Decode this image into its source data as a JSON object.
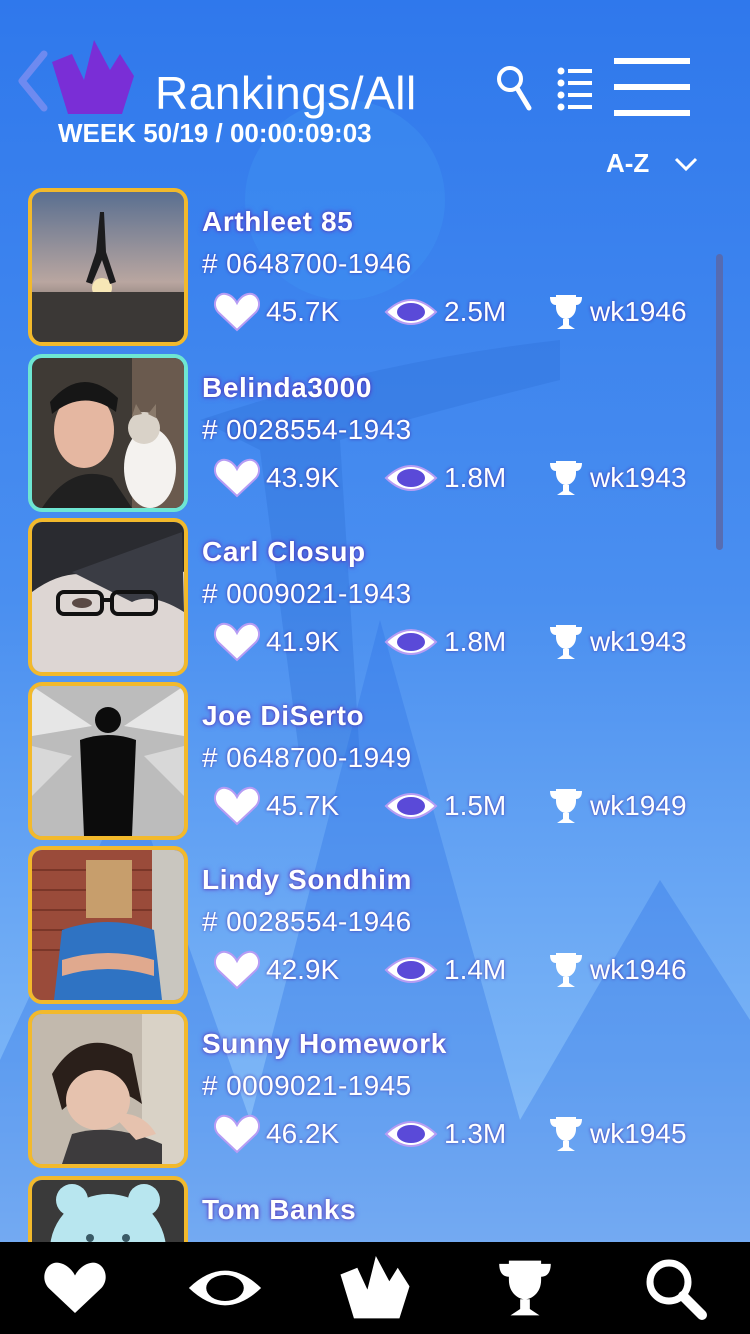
{
  "header": {
    "title": "Rankings/All",
    "subtitle": "WEEK 50/19 / 00:00:09:03",
    "sort_label": "A-Z"
  },
  "colors": {
    "accent_purple": "#7a2ed6",
    "avatar_border_gold": "#f2b92c",
    "avatar_border_teal": "#6ee6d2",
    "nav_bg": "#000000"
  },
  "icons": {
    "back": "chevron-left-icon",
    "logo": "crown-logo",
    "search": "search-icon",
    "list": "list-icon",
    "menu": "hamburger-menu-icon",
    "sort": "chevron-down-icon",
    "likes": "heart-icon",
    "views": "eye-icon",
    "rank": "trophy-icon"
  },
  "rankings": [
    {
      "name": "Arthleet 85",
      "code": "# 0648700-1946",
      "likes": "45.7K",
      "views": "2.5M",
      "week": "wk1946"
    },
    {
      "name": "Belinda3000",
      "code": "# 0028554-1943",
      "likes": "43.9K",
      "views": "1.8M",
      "week": "wk1943"
    },
    {
      "name": "Carl Closup",
      "code": "# 0009021-1943",
      "likes": "41.9K",
      "views": "1.8M",
      "week": "wk1943"
    },
    {
      "name": "Joe DiSerto",
      "code": "# 0648700-1949",
      "likes": "45.7K",
      "views": "1.5M",
      "week": "wk1949"
    },
    {
      "name": "Lindy Sondhim",
      "code": "# 0028554-1946",
      "likes": "42.9K",
      "views": "1.4M",
      "week": "wk1946"
    },
    {
      "name": "Sunny Homework",
      "code": "# 0009021-1945",
      "likes": "46.2K",
      "views": "1.3M",
      "week": "wk1945"
    },
    {
      "name": "Tom Banks"
    }
  ],
  "bottom_nav": [
    "heart-icon",
    "eye-icon",
    "crown-logo",
    "trophy-icon",
    "search-icon"
  ]
}
